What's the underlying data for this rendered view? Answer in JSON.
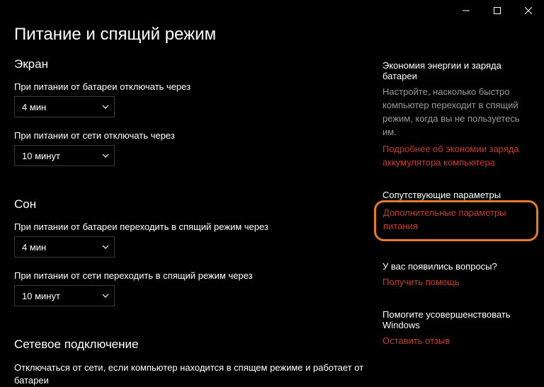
{
  "titlebar": {
    "minimize": "minimize",
    "maximize": "maximize",
    "close": "close"
  },
  "page_title": "Питание и спящий режим",
  "screen": {
    "title": "Экран",
    "battery_label": "При питании от батареи отключать через",
    "battery_value": "4 мин",
    "plugged_label": "При питании от сети отключать через",
    "plugged_value": "10 минут"
  },
  "sleep": {
    "title": "Сон",
    "battery_label": "При питании от батареи переходить в спящий режим через",
    "battery_value": "4 мин",
    "plugged_label": "При питании от сети переходить в спящий режим через",
    "plugged_value": "10 минут"
  },
  "network": {
    "title": "Сетевое подключение",
    "desc": "Отключаться от сети, если компьютер находится в спящем режиме и работает от батареи"
  },
  "side": {
    "battery_saver": {
      "title": "Экономия энергии и заряда батареи",
      "text": "Настройте, насколько быстро компьютер переходит в спящий режим, когда вы не пользуетесь им.",
      "link": "Подробнее об экономии заряда аккумулятора компьютера"
    },
    "related": {
      "title": "Сопутствующие параметры",
      "link": "Дополнительные параметры питания"
    },
    "help": {
      "title": "У вас появились вопросы?",
      "link": "Получить помощь"
    },
    "feedback": {
      "title": "Помогите усовершенствовать Windows",
      "link": "Оставить отзыв"
    }
  }
}
